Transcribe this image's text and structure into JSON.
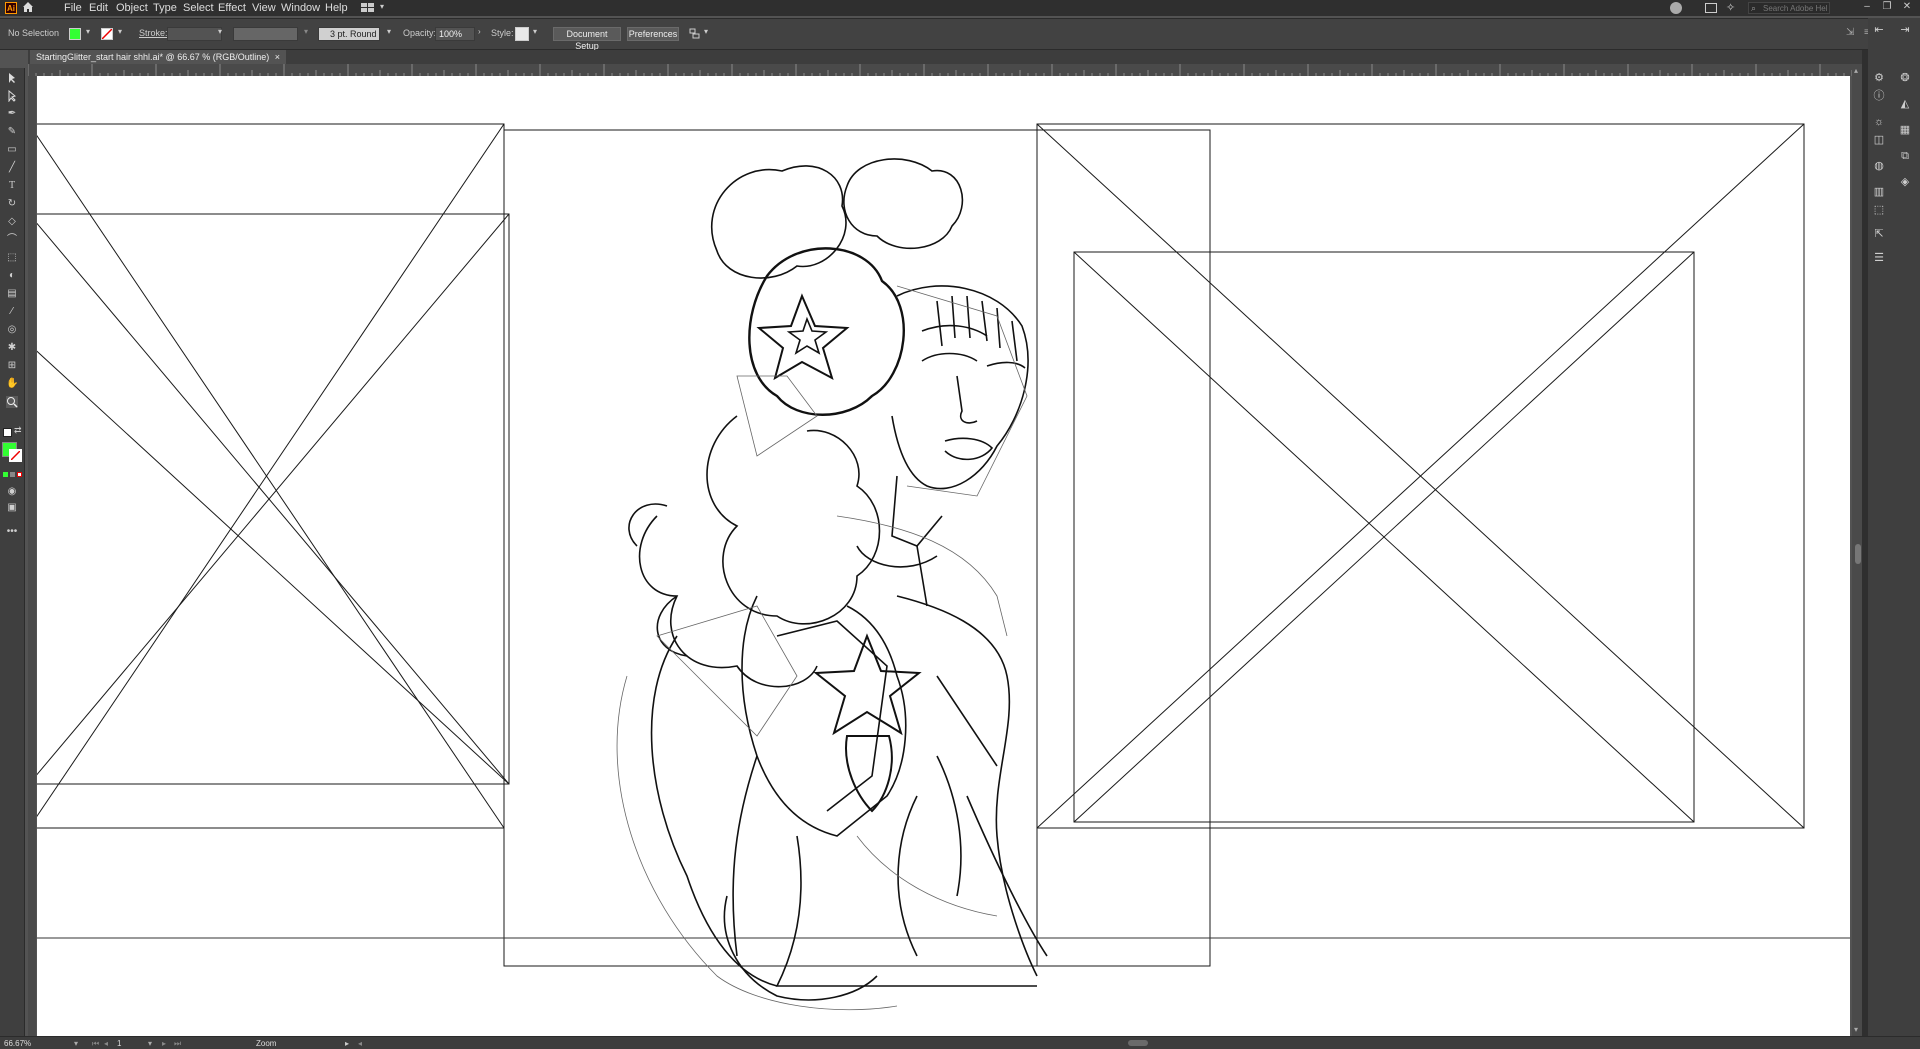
{
  "app": {
    "logo_text": "Ai",
    "menus": [
      "File",
      "Edit",
      "Object",
      "Type",
      "Select",
      "Effect",
      "View",
      "Window",
      "Help"
    ],
    "search_placeholder": "Search Adobe Help"
  },
  "control_bar": {
    "selection_status": "No Selection",
    "fill_color": "#33ff33",
    "stroke_label": "Stroke:",
    "brush_value": "3 pt. Round",
    "opacity_label": "Opacity:",
    "opacity_value": "100%",
    "style_label": "Style:",
    "document_setup_label": "Document Setup",
    "preferences_label": "Preferences"
  },
  "document_tab": {
    "title": "StartingGlitter_start hair shhl.ai* @ 66.67 % (RGB/Outline)",
    "close_glyph": "×"
  },
  "status_bar": {
    "zoom_value": "66.67%",
    "artboard_number": "1",
    "tool_name": "Zoom"
  },
  "toolbar": {
    "tools": [
      "selection-tool",
      "direct-selection-tool",
      "pen-tool",
      "curvature-tool",
      "rectangle-tool",
      "paintbrush-tool",
      "type-tool",
      "rotate-tool",
      "eraser-tool",
      "width-tool",
      "gradient-tool",
      "eyedropper-tool",
      "blend-tool",
      "symbol-sprayer-tool",
      "artboard-tool",
      "zoom-tool"
    ],
    "fill_color": "#33ff33"
  },
  "colors": {
    "ui_dark": "#2f2f2f",
    "ui_panel": "#424242",
    "accent_fill": "#33ff33"
  }
}
